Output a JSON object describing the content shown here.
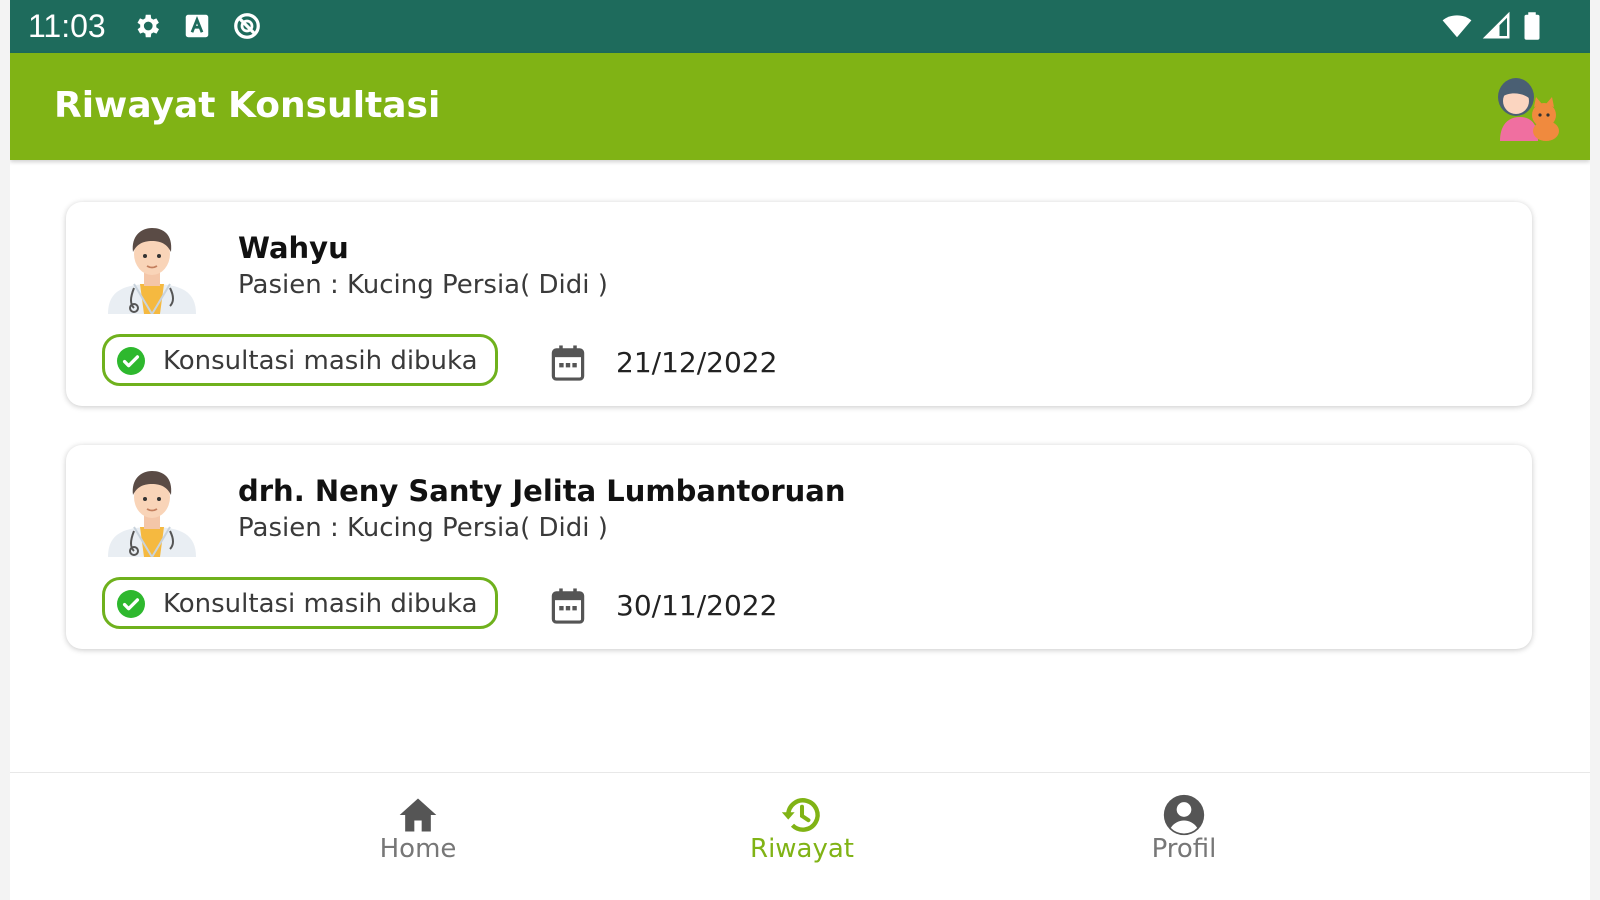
{
  "status_bar": {
    "time": "11:03",
    "left_icons": [
      "gear-icon",
      "a-box-icon",
      "no-sync-icon"
    ],
    "right_icons": [
      "wifi-icon",
      "signal-icon",
      "battery-icon"
    ],
    "background": "#1e6b5c"
  },
  "app_bar": {
    "title": "Riwayat Konsultasi",
    "background": "#80b315",
    "avatar_icon": "woman-with-cat-avatar"
  },
  "consultations": [
    {
      "doctor_name": "Wahyu",
      "patient": "Pasien : Kucing Persia( Didi )",
      "status": "Konsultasi masih dibuka",
      "date": "21/12/2022"
    },
    {
      "doctor_name": "drh. Neny Santy Jelita Lumbantoruan",
      "patient": "Pasien : Kucing Persia( Didi )",
      "status": "Konsultasi masih dibuka",
      "date": "30/11/2022"
    }
  ],
  "bottom_nav": {
    "active": "Riwayat",
    "accent_color": "#80b315",
    "items": [
      {
        "label": "Home",
        "icon": "home-icon"
      },
      {
        "label": "Riwayat",
        "icon": "history-icon"
      },
      {
        "label": "Profil",
        "icon": "profile-icon"
      }
    ]
  }
}
